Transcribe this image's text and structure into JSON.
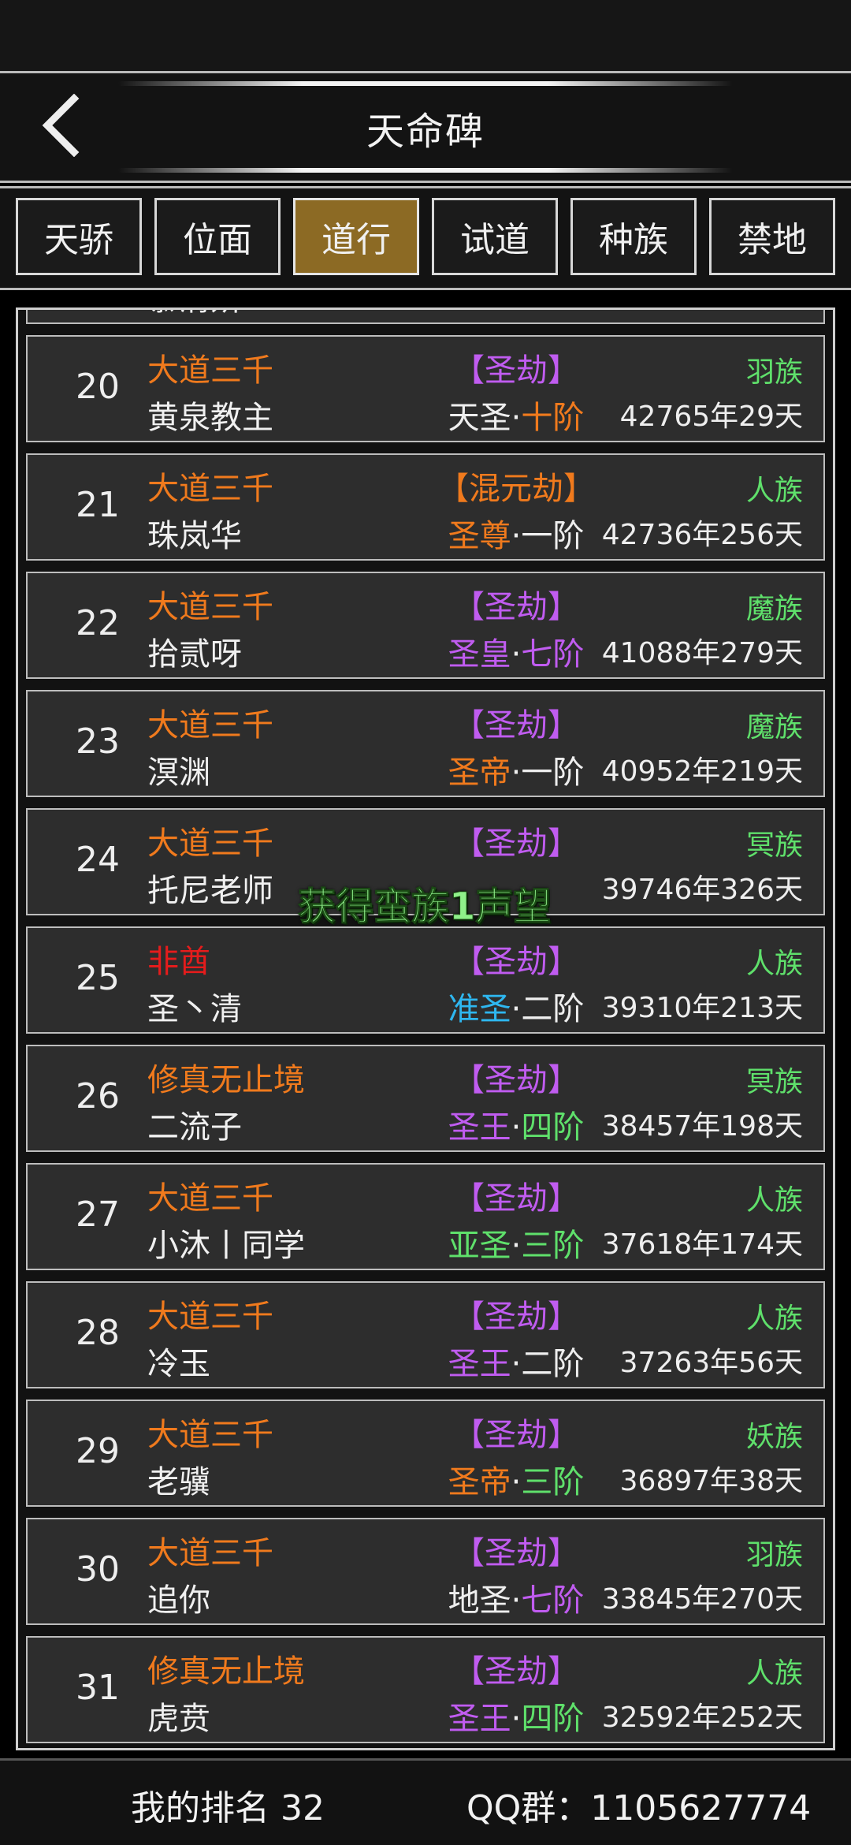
{
  "header": {
    "title": "天命碑"
  },
  "tabs": [
    "天骄",
    "位面",
    "道行",
    "试道",
    "种族",
    "禁地"
  ],
  "active_tab": 2,
  "colors": {
    "orange": "#f07a1d",
    "red": "#e51c1c",
    "purple": "#c05cf0",
    "green": "#5fe06b",
    "cyan": "#2eb7f0",
    "white": "#eeeeee",
    "gold_tab": "#8c6a24"
  },
  "rows": [
    {
      "rank": "",
      "guild": "",
      "guild_color": "orange",
      "name": "慕清妍",
      "tier": "",
      "realm_a": "",
      "realm_a_color": "green",
      "realm_b": "",
      "realm_b_color": "green",
      "race": "",
      "time": ""
    },
    {
      "rank": "20",
      "guild": "大道三千",
      "guild_color": "orange",
      "name": "黄泉教主",
      "tier": "【圣劫】",
      "realm_a": "天圣",
      "realm_a_color": "white",
      "realm_b": "十阶",
      "realm_b_color": "orange",
      "race": "羽族",
      "time": "42765年29天"
    },
    {
      "rank": "21",
      "guild": "大道三千",
      "guild_color": "orange",
      "name": "珠岚华",
      "tier": "【混元劫】",
      "tier_color": "orange",
      "realm_a": "圣尊",
      "realm_a_color": "orange",
      "realm_b": "一阶",
      "realm_b_color": "white",
      "race": "人族",
      "time": "42736年256天"
    },
    {
      "rank": "22",
      "guild": "大道三千",
      "guild_color": "orange",
      "name": "拾贰呀",
      "tier": "【圣劫】",
      "realm_a": "圣皇",
      "realm_a_color": "purple",
      "realm_b": "七阶",
      "realm_b_color": "purple",
      "race": "魔族",
      "time": "41088年279天"
    },
    {
      "rank": "23",
      "guild": "大道三千",
      "guild_color": "orange",
      "name": "溟渊",
      "tier": "【圣劫】",
      "realm_a": "圣帝",
      "realm_a_color": "orange",
      "realm_b": "一阶",
      "realm_b_color": "white",
      "race": "魔族",
      "time": "40952年219天"
    },
    {
      "rank": "24",
      "guild": "大道三千",
      "guild_color": "orange",
      "name": "托尼老师",
      "tier": "【圣劫】",
      "realm_a": "",
      "realm_a_color": "orange",
      "realm_b": "",
      "realm_b_color": "white",
      "race": "冥族",
      "time": "39746年326天"
    },
    {
      "rank": "25",
      "guild": "非酋",
      "guild_color": "red",
      "name": "圣丶清",
      "tier": "【圣劫】",
      "realm_a": "准圣",
      "realm_a_color": "cyan",
      "realm_b": "二阶",
      "realm_b_color": "white",
      "race": "人族",
      "time": "39310年213天"
    },
    {
      "rank": "26",
      "guild": "修真无止境",
      "guild_color": "orange",
      "name": "二流子",
      "tier": "【圣劫】",
      "realm_a": "圣王",
      "realm_a_color": "purple",
      "realm_b": "四阶",
      "realm_b_color": "green",
      "race": "冥族",
      "time": "38457年198天"
    },
    {
      "rank": "27",
      "guild": "大道三千",
      "guild_color": "orange",
      "name": "小沐丨同学",
      "tier": "【圣劫】",
      "realm_a": "亚圣",
      "realm_a_color": "green",
      "realm_b": "三阶",
      "realm_b_color": "green",
      "race": "人族",
      "time": "37618年174天"
    },
    {
      "rank": "28",
      "guild": "大道三千",
      "guild_color": "orange",
      "name": "冷玉",
      "tier": "【圣劫】",
      "realm_a": "圣王",
      "realm_a_color": "purple",
      "realm_b": "二阶",
      "realm_b_color": "white",
      "race": "人族",
      "time": "37263年56天"
    },
    {
      "rank": "29",
      "guild": "大道三千",
      "guild_color": "orange",
      "name": "老骥",
      "tier": "【圣劫】",
      "realm_a": "圣帝",
      "realm_a_color": "orange",
      "realm_b": "三阶",
      "realm_b_color": "green",
      "race": "妖族",
      "time": "36897年38天"
    },
    {
      "rank": "30",
      "guild": "大道三千",
      "guild_color": "orange",
      "name": "追你",
      "tier": "【圣劫】",
      "realm_a": "地圣",
      "realm_a_color": "white",
      "realm_b": "七阶",
      "realm_b_color": "purple",
      "race": "羽族",
      "time": "33845年270天"
    },
    {
      "rank": "31",
      "guild": "修真无止境",
      "guild_color": "orange",
      "name": "虎贲",
      "tier": "【圣劫】",
      "realm_a": "圣王",
      "realm_a_color": "purple",
      "realm_b": "四阶",
      "realm_b_color": "green",
      "race": "人族",
      "time": "32592年252天"
    }
  ],
  "toast": "获得蛮族1声望",
  "footer": {
    "my_rank": "我的排名 32",
    "qq": "QQ群：1105627774"
  }
}
